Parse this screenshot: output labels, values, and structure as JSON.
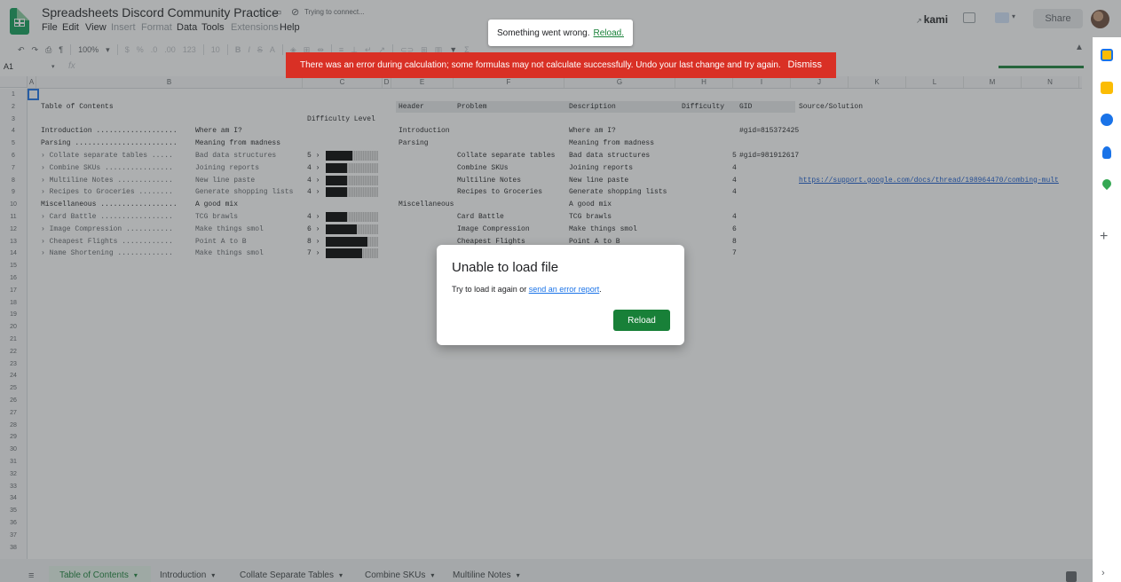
{
  "header": {
    "title": "Spreadsheets Discord Community Practice",
    "sync_status": "Trying to connect...",
    "menus": [
      {
        "label": "File",
        "enabled": true
      },
      {
        "label": "Edit",
        "enabled": true
      },
      {
        "label": "View",
        "enabled": true
      },
      {
        "label": "Insert",
        "enabled": false
      },
      {
        "label": "Format",
        "enabled": false
      },
      {
        "label": "Data",
        "enabled": true
      },
      {
        "label": "Tools",
        "enabled": true
      },
      {
        "label": "Extensions",
        "enabled": false
      },
      {
        "label": "Help",
        "enabled": true
      }
    ],
    "kami_label": "kami",
    "share_label": "Share"
  },
  "toolbar": {
    "zoom": "100%",
    "currency": "$",
    "percent": "%",
    "decimal_less": ".0",
    "decimal_more": ".00",
    "format_more": "123",
    "font_size": "10"
  },
  "formula_bar": {
    "name_box": "A1"
  },
  "toast": {
    "message": "Something went wrong.",
    "link": "Reload."
  },
  "banner": {
    "message": "There was an error during calculation; some formulas may not calculate successfully. Undo your last change and try again.",
    "dismiss": "Dismiss"
  },
  "dialog": {
    "title": "Unable to load file",
    "body_prefix": "Try to load it again or ",
    "body_link": "send an error report",
    "body_suffix": ".",
    "button": "Reload"
  },
  "grid": {
    "columns": [
      "A",
      "B",
      "C",
      "D",
      "E",
      "F",
      "G",
      "H",
      "I",
      "J",
      "K",
      "L",
      "M",
      "N"
    ],
    "rows": [
      "1",
      "2",
      "3",
      "4",
      "5",
      "6",
      "7",
      "8",
      "9",
      "10",
      "11",
      "12",
      "13",
      "14",
      "15",
      "16",
      "17",
      "18",
      "19",
      "20",
      "21",
      "22",
      "23",
      "24",
      "25",
      "26",
      "27",
      "28",
      "29",
      "30",
      "31",
      "32",
      "33",
      "34",
      "35",
      "36",
      "37",
      "38"
    ],
    "toc_title": "Table of Contents",
    "difficulty_header": "Difficulty Level",
    "toc": [
      {
        "name": "Introduction ...................",
        "desc": "Where am I?",
        "sub": false,
        "level": "",
        "fill": 0
      },
      {
        "name": "Parsing ........................",
        "desc": "Meaning from madness",
        "sub": false,
        "level": "",
        "fill": 0
      },
      {
        "name": "› Collate separate tables .....",
        "desc": "Bad data structures",
        "sub": true,
        "level": "5 ›",
        "fill": 0.5
      },
      {
        "name": "› Combine SKUs ................",
        "desc": "Joining reports",
        "sub": true,
        "level": "4 ›",
        "fill": 0.4
      },
      {
        "name": "› Multiline Notes .............",
        "desc": "New line paste",
        "sub": true,
        "level": "4 ›",
        "fill": 0.4
      },
      {
        "name": "› Recipes to Groceries ........",
        "desc": "Generate shopping lists",
        "sub": true,
        "level": "4 ›",
        "fill": 0.4
      },
      {
        "name": "Miscellaneous ..................",
        "desc": "A good mix",
        "sub": false,
        "level": "",
        "fill": 0
      },
      {
        "name": "› Card Battle .................",
        "desc": "TCG brawls",
        "sub": true,
        "level": "4 ›",
        "fill": 0.4
      },
      {
        "name": "› Image Compression ...........",
        "desc": "Make things smol",
        "sub": true,
        "level": "6 ›",
        "fill": 0.6
      },
      {
        "name": "› Cheapest Flights ............",
        "desc": "Point A to B",
        "sub": true,
        "level": "8 ›",
        "fill": 0.8
      },
      {
        "name": "› Name Shortening .............",
        "desc": "Make things smol",
        "sub": true,
        "level": "7 ›",
        "fill": 0.7
      }
    ],
    "table_headers": [
      "Header",
      "Problem",
      "Description",
      "Difficulty",
      "GID",
      "Source/Solution"
    ],
    "table": [
      {
        "e": "Introduction",
        "f": "",
        "g": "Where am I?",
        "h": "",
        "i": "#gid=815372425",
        "j": ""
      },
      {
        "e": "Parsing",
        "f": "",
        "g": "Meaning from madness",
        "h": "",
        "i": "",
        "j": ""
      },
      {
        "e": "",
        "f": "Collate separate tables",
        "g": "Bad data structures",
        "h": "5",
        "i": "#gid=981912617",
        "j": ""
      },
      {
        "e": "",
        "f": "Combine SKUs",
        "g": "Joining reports",
        "h": "4",
        "i": "",
        "j": ""
      },
      {
        "e": "",
        "f": "Multiline Notes",
        "g": "New line paste",
        "h": "4",
        "i": "",
        "j": "https://support.google.com/docs/thread/198964470/combing-mult"
      },
      {
        "e": "",
        "f": "Recipes to Groceries",
        "g": "Generate shopping lists",
        "h": "4",
        "i": "",
        "j": ""
      },
      {
        "e": "Miscellaneous",
        "f": "",
        "g": "A good mix",
        "h": "",
        "i": "",
        "j": ""
      },
      {
        "e": "",
        "f": "Card Battle",
        "g": "TCG brawls",
        "h": "4",
        "i": "",
        "j": ""
      },
      {
        "e": "",
        "f": "Image Compression",
        "g": "Make things smol",
        "h": "6",
        "i": "",
        "j": ""
      },
      {
        "e": "",
        "f": "Cheapest Flights",
        "g": "Point A to B",
        "h": "8",
        "i": "",
        "j": ""
      },
      {
        "e": "",
        "f": "",
        "g": "",
        "h": "7",
        "i": "",
        "j": ""
      }
    ]
  },
  "sheet_tabs": [
    {
      "label": "Table of Contents",
      "active": true
    },
    {
      "label": "Introduction",
      "active": false
    },
    {
      "label": "Collate Separate Tables",
      "active": false
    },
    {
      "label": "Combine SKUs",
      "active": false
    },
    {
      "label": "Multiline Notes",
      "active": false
    }
  ],
  "right_rail": [
    "sheets-icon",
    "keep-icon",
    "tasks-icon",
    "contacts-icon",
    "maps-icon"
  ]
}
